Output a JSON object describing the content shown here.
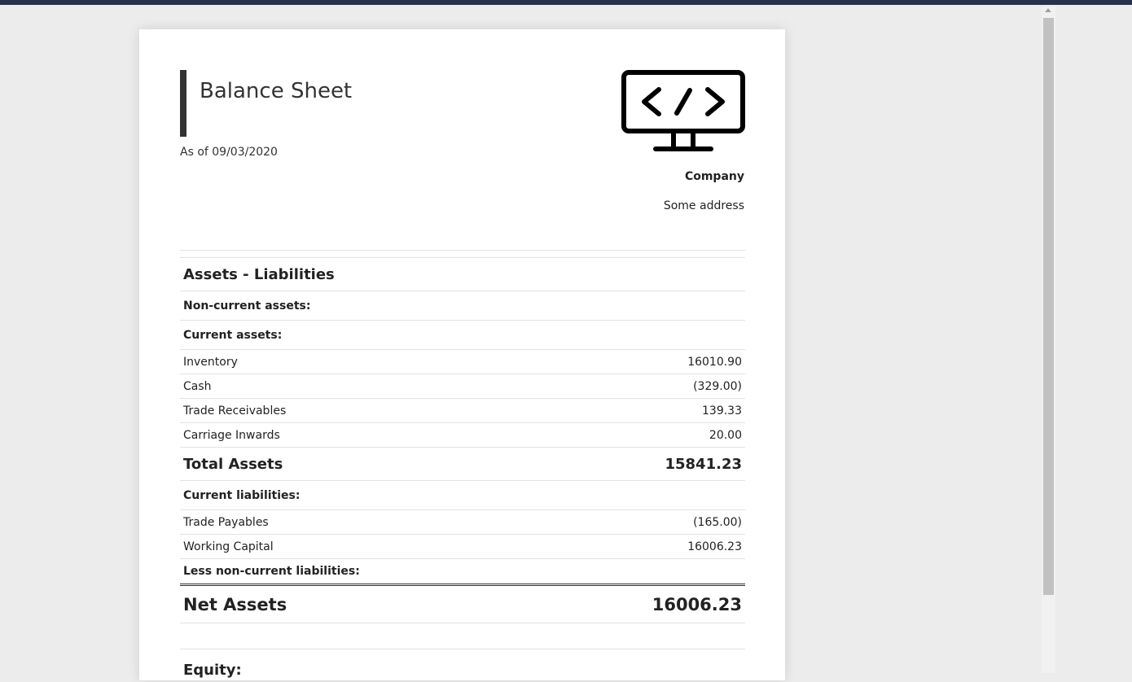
{
  "document": {
    "title": "Balance Sheet",
    "date_line": "As of 09/03/2020",
    "logo_icon": "code-monitor-icon",
    "company_name": "Company",
    "company_address": "Some address"
  },
  "balance_sheet": {
    "section_title": "Assets - Liabilities",
    "non_current_assets_label": "Non-current assets:",
    "current_assets_label": "Current assets:",
    "current_assets": [
      {
        "label": "Inventory",
        "value": "16010.90"
      },
      {
        "label": "Cash",
        "value": "(329.00)"
      },
      {
        "label": "Trade Receivables",
        "value": "139.33"
      },
      {
        "label": "Carriage Inwards",
        "value": "20.00"
      }
    ],
    "total_assets_label": "Total Assets",
    "total_assets_value": "15841.23",
    "current_liabilities_label": "Current liabilities:",
    "current_liabilities": [
      {
        "label": "Trade Payables",
        "value": "(165.00)"
      },
      {
        "label": "Working Capital",
        "value": "16006.23"
      }
    ],
    "non_current_liabilities_label": "Less non-current liabilities:",
    "net_assets_label": "Net Assets",
    "net_assets_value": "16006.23",
    "equity_label": "Equity:"
  },
  "colors": {
    "topbar": "#25324a",
    "background": "#ececec",
    "title_bar": "#333333"
  }
}
